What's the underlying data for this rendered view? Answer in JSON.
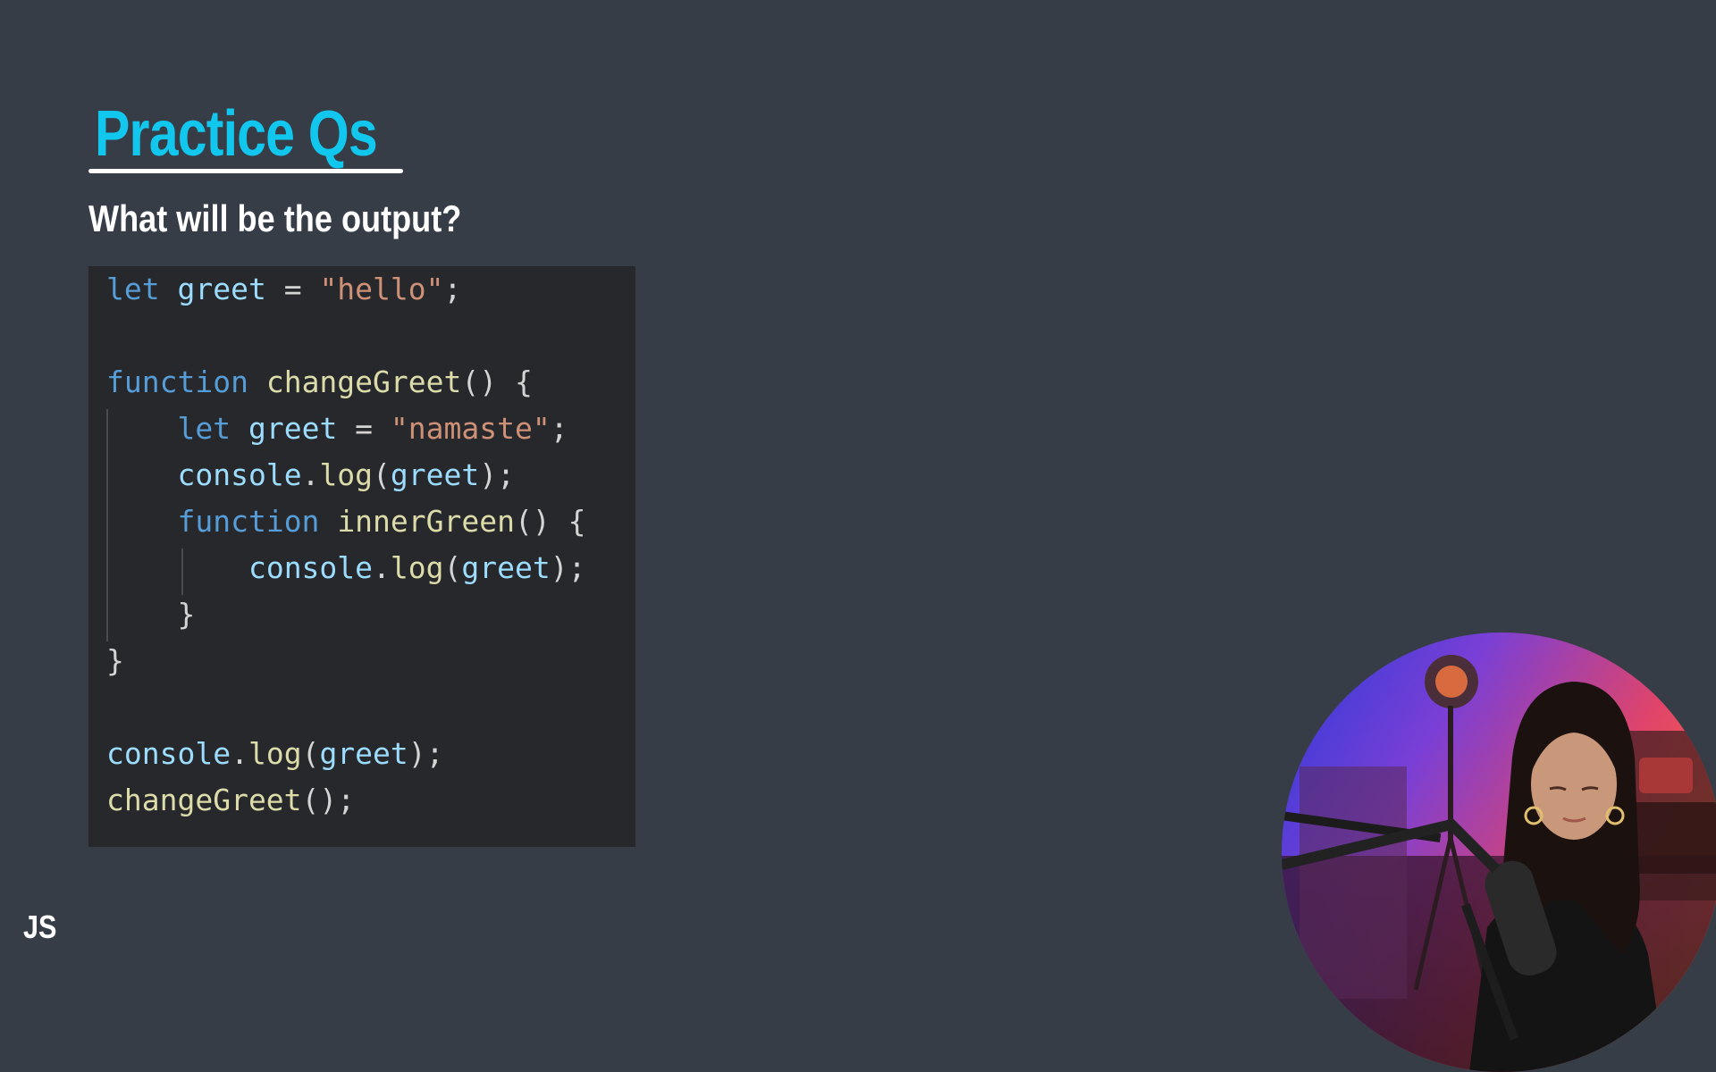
{
  "slide": {
    "title": "Practice Qs",
    "question": "What will be the output?",
    "badge": "JS"
  },
  "code": {
    "language": "javascript",
    "lines": [
      [
        {
          "t": "let",
          "c": "kw"
        },
        {
          "t": " ",
          "c": "punc"
        },
        {
          "t": "greet",
          "c": "var"
        },
        {
          "t": " = ",
          "c": "punc"
        },
        {
          "t": "\"hello\"",
          "c": "str"
        },
        {
          "t": ";",
          "c": "punc"
        }
      ],
      [],
      [
        {
          "t": "function",
          "c": "kw"
        },
        {
          "t": " ",
          "c": "punc"
        },
        {
          "t": "changeGreet",
          "c": "fn"
        },
        {
          "t": "() {",
          "c": "punc"
        }
      ],
      [
        {
          "t": "    ",
          "c": "punc"
        },
        {
          "t": "let",
          "c": "kw"
        },
        {
          "t": " ",
          "c": "punc"
        },
        {
          "t": "greet",
          "c": "var"
        },
        {
          "t": " = ",
          "c": "punc"
        },
        {
          "t": "\"namaste\"",
          "c": "str"
        },
        {
          "t": ";",
          "c": "punc"
        }
      ],
      [
        {
          "t": "    ",
          "c": "punc"
        },
        {
          "t": "console",
          "c": "obj"
        },
        {
          "t": ".",
          "c": "punc"
        },
        {
          "t": "log",
          "c": "fn"
        },
        {
          "t": "(",
          "c": "punc"
        },
        {
          "t": "greet",
          "c": "var"
        },
        {
          "t": ");",
          "c": "punc"
        }
      ],
      [
        {
          "t": "    ",
          "c": "punc"
        },
        {
          "t": "function",
          "c": "kw"
        },
        {
          "t": " ",
          "c": "punc"
        },
        {
          "t": "innerGreen",
          "c": "fn"
        },
        {
          "t": "() {",
          "c": "punc"
        }
      ],
      [
        {
          "t": "        ",
          "c": "punc"
        },
        {
          "t": "console",
          "c": "obj"
        },
        {
          "t": ".",
          "c": "punc"
        },
        {
          "t": "log",
          "c": "fn"
        },
        {
          "t": "(",
          "c": "punc"
        },
        {
          "t": "greet",
          "c": "var"
        },
        {
          "t": ");",
          "c": "punc"
        }
      ],
      [
        {
          "t": "    }",
          "c": "punc"
        }
      ],
      [
        {
          "t": "}",
          "c": "punc"
        }
      ],
      [],
      [
        {
          "t": "console",
          "c": "obj"
        },
        {
          "t": ".",
          "c": "punc"
        },
        {
          "t": "log",
          "c": "fn"
        },
        {
          "t": "(",
          "c": "punc"
        },
        {
          "t": "greet",
          "c": "var"
        },
        {
          "t": ");",
          "c": "punc"
        }
      ],
      [
        {
          "t": "changeGreet",
          "c": "fn"
        },
        {
          "t": "();",
          "c": "punc"
        }
      ]
    ]
  },
  "colors": {
    "background": "#363d47",
    "title": "#12c7ee",
    "code_background": "#27282b",
    "keyword": "#569cd6",
    "variable": "#9cdcfe",
    "function": "#dcdcaa",
    "string": "#ce9178",
    "punctuation": "#d4d4d4"
  },
  "webcam": {
    "icon": "presenter-webcam-icon"
  }
}
